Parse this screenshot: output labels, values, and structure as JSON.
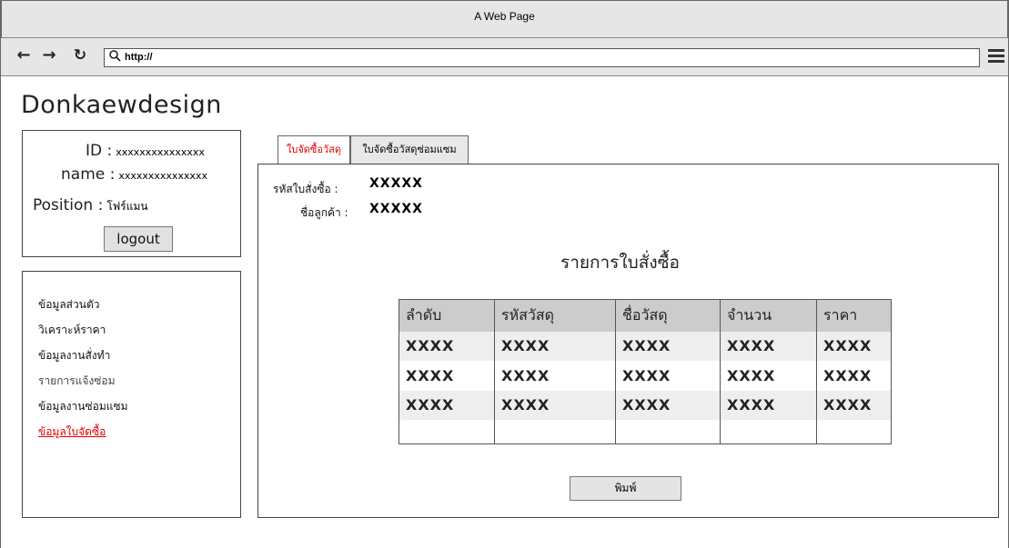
{
  "window": {
    "title": "A Web Page"
  },
  "browser": {
    "back_icon": "back-arrow-icon",
    "forward_icon": "forward-arrow-icon",
    "reload_icon": "reload-icon",
    "url": "http://",
    "menu_icon": "hamburger-menu-icon"
  },
  "brand": "Donkaewdesign",
  "profile": {
    "id_label": "ID :",
    "id_value": "xxxxxxxxxxxxxxx",
    "name_label": "name :",
    "name_value": "xxxxxxxxxxxxxxx",
    "position_label": "Position :",
    "position_value": "โฟร์แมน",
    "logout_label": "logout"
  },
  "sidebar": {
    "items": [
      {
        "label": "ข้อมูลส่วนตัว"
      },
      {
        "label": "วิเคราะห์ราคา"
      },
      {
        "label": "ข้อมูลงานสั่งทำ"
      },
      {
        "label": "รายการแจ้งซ่อม"
      },
      {
        "label": "ข้อมูลงานซ่อมแซม"
      },
      {
        "label": "ข้อมูลใบจัดซื้อ"
      }
    ],
    "active_index": 5
  },
  "tabs": [
    {
      "label": "ใบจัดซื้อวัสดุ",
      "active": true
    },
    {
      "label": "ใบจัดซื้อวัสดุซ่อมแซม",
      "active": false
    }
  ],
  "order": {
    "order_id_label": "รหัสใบสั่งซื้อ :",
    "order_id_value": "XXXXX",
    "customer_label": "ชื่อลูกค้า :",
    "customer_value": "XXXXX",
    "section_title": "รายการใบสั่งซื้อ",
    "table": {
      "headers": [
        "ลำดับ",
        "รหัสวัสดุ",
        "ชื่อวัสดุ",
        "จำนวน",
        "ราคา"
      ],
      "rows": [
        [
          "XXXX",
          "XXXX",
          "XXXX",
          "XXXX",
          "XXXX"
        ],
        [
          "XXXX",
          "XXXX",
          "XXXX",
          "XXXX",
          "XXXX"
        ],
        [
          "XXXX",
          "XXXX",
          "XXXX",
          "XXXX",
          "XXXX"
        ],
        [
          "",
          "",
          "",
          "",
          ""
        ]
      ]
    },
    "print_label": "พิมพ์"
  },
  "colors": {
    "active": "#e00000",
    "header_bg": "#cccccc",
    "chrome_bg": "#e6e6e6"
  }
}
